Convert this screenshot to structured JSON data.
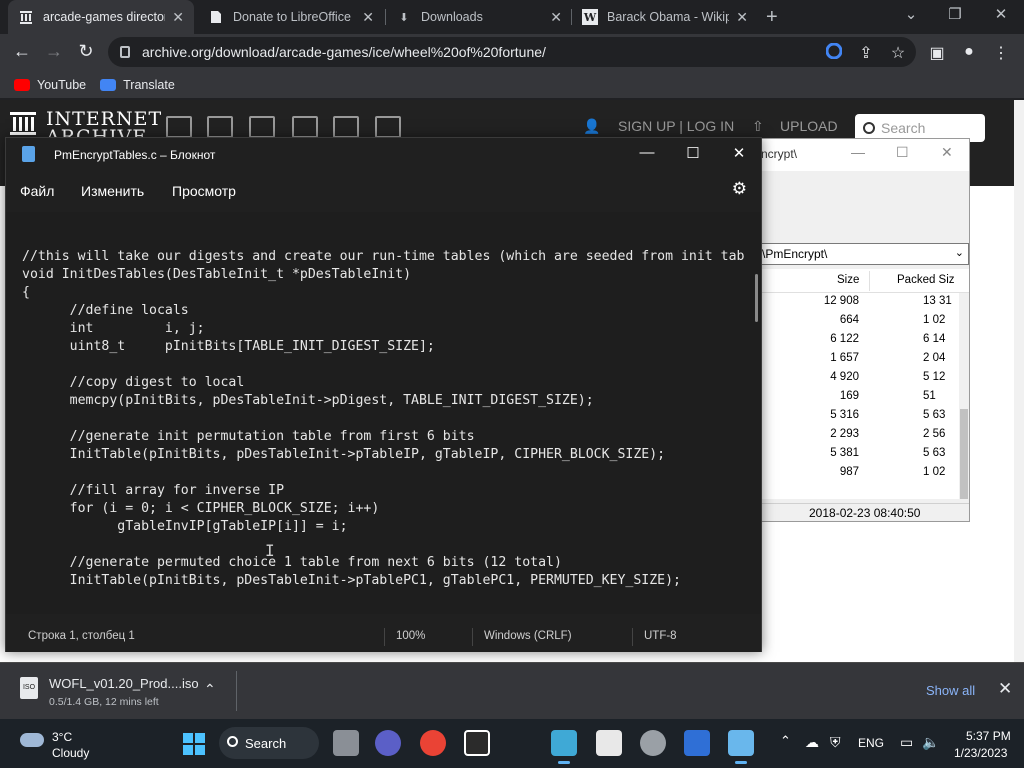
{
  "browser": {
    "tabs": [
      {
        "title": "arcade-games director",
        "icon": "internet-archive-icon"
      },
      {
        "title": "Donate to LibreOffice |",
        "icon": "page-icon"
      },
      {
        "title": "Downloads",
        "icon": "download-icon"
      },
      {
        "title": "Barack Obama - Wikipe",
        "icon": "wikipedia-icon"
      }
    ],
    "url": "archive.org/download/arcade-games/ice/wheel%20of%20fortune/",
    "bookmarks": [
      {
        "label": "YouTube",
        "color": "#ff0000"
      },
      {
        "label": "Translate",
        "color": "#4285f4"
      }
    ]
  },
  "archive_page": {
    "logo_line1": "INTERNET",
    "logo_line2": "ARCHIVE",
    "signin": "SIGN UP | LOG IN",
    "upload": "UPLOAD",
    "search_placeholder": "Search"
  },
  "zip_window": {
    "title_fragment": "ncrypt\\",
    "address": "\\PmEncrypt\\",
    "columns": [
      "Size",
      "Packed Siz"
    ],
    "rows": [
      [
        "12 908",
        "13 31"
      ],
      [
        "664",
        "1 02"
      ],
      [
        "6 122",
        "6 14"
      ],
      [
        "1 657",
        "2 04"
      ],
      [
        "4 920",
        "5 12"
      ],
      [
        "169",
        "51"
      ],
      [
        "5 316",
        "5 63"
      ],
      [
        "2 293",
        "2 56"
      ],
      [
        "5 381",
        "5 63"
      ],
      [
        "987",
        "1 02"
      ]
    ],
    "status_date": "2018-02-23 08:40:50"
  },
  "notepad": {
    "title": "PmEncryptTables.c – Блокнот",
    "menu": [
      "Файл",
      "Изменить",
      "Просмотр"
    ],
    "code": [
      "//this will take our digests and create our run-time tables (which are seeded from init tab",
      "void InitDesTables(DesTableInit_t *pDesTableInit)",
      "{",
      "      //define locals",
      "      int         i, j;",
      "      uint8_t     pInitBits[TABLE_INIT_DIGEST_SIZE];",
      "",
      "      //copy digest to local",
      "      memcpy(pInitBits, pDesTableInit->pDigest, TABLE_INIT_DIGEST_SIZE);",
      "",
      "      //generate init permutation table from first 6 bits",
      "      InitTable(pInitBits, pDesTableInit->pTableIP, gTableIP, CIPHER_BLOCK_SIZE);",
      "",
      "      //fill array for inverse IP",
      "      for (i = 0; i < CIPHER_BLOCK_SIZE; i++)",
      "            gTableInvIP[gTableIP[i]] = i;",
      "",
      "      //generate permuted choice 1 table from next 6 bits (12 total)",
      "      InitTable(pInitBits, pDesTableInit->pTablePC1, gTablePC1, PERMUTED_KEY_SIZE);"
    ],
    "status": {
      "position": "Строка 1, столбец 1",
      "zoom": "100%",
      "line_endings": "Windows (CRLF)",
      "encoding": "UTF-8"
    }
  },
  "download": {
    "filename": "WOFL_v01.20_Prod....iso",
    "progress": "0.5/1.4 GB, 12 mins left",
    "file_badge": "ISO",
    "show_all": "Show all"
  },
  "taskbar": {
    "weather_temp": "3°C",
    "weather_desc": "Cloudy",
    "search": "Search",
    "lang": "ENG",
    "time": "5:37 PM",
    "date": "1/23/2023"
  }
}
